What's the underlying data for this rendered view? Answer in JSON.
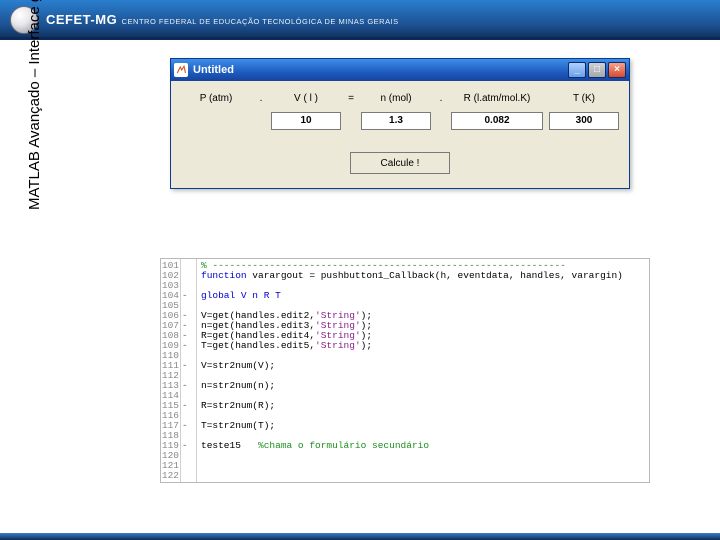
{
  "header": {
    "brand_main": "CEFET",
    "brand_suffix": "-MG",
    "brand_sub": "CENTRO FEDERAL DE EDUCAÇÃO TECNOLÓGICA DE MINAS GERAIS"
  },
  "side_title": "MATLAB  Avançado – Interface gráfica",
  "gui_window": {
    "title": "Untitled",
    "controls": {
      "min": "_",
      "max": "□",
      "close": "×"
    },
    "labels": {
      "P": "P (atm)",
      "V": "V ( l )",
      "eq": "=",
      "dot": ".",
      "n": "n (mol)",
      "R": "R (l.atm/mol.K)",
      "T": "T (K)"
    },
    "values": {
      "V": "10",
      "n": "1.3",
      "R": "0.082",
      "T": "300"
    },
    "button_label": "Calcule !"
  },
  "editor": {
    "lines": [
      {
        "n": "101",
        "b": "",
        "cls": "cmt",
        "t": "% --------------------------------------------------------------"
      },
      {
        "n": "102",
        "b": "",
        "cls": "",
        "t": "function varargout = pushbutton1_Callback(h, eventdata, handles, varargin)"
      },
      {
        "n": "103",
        "b": "",
        "cls": "",
        "t": ""
      },
      {
        "n": "104",
        "b": "-",
        "cls": "kw",
        "t": "global V n R T"
      },
      {
        "n": "105",
        "b": "",
        "cls": "",
        "t": ""
      },
      {
        "n": "106",
        "b": "-",
        "cls": "",
        "t": "V=get(handles.edit2,'String');"
      },
      {
        "n": "107",
        "b": "-",
        "cls": "",
        "t": "n=get(handles.edit3,'String');"
      },
      {
        "n": "108",
        "b": "-",
        "cls": "",
        "t": "R=get(handles.edit4,'String');"
      },
      {
        "n": "109",
        "b": "-",
        "cls": "",
        "t": "T=get(handles.edit5,'String');"
      },
      {
        "n": "110",
        "b": "",
        "cls": "",
        "t": ""
      },
      {
        "n": "111",
        "b": "-",
        "cls": "",
        "t": "V=str2num(V);"
      },
      {
        "n": "112",
        "b": "",
        "cls": "",
        "t": ""
      },
      {
        "n": "113",
        "b": "-",
        "cls": "",
        "t": "n=str2num(n);"
      },
      {
        "n": "114",
        "b": "",
        "cls": "",
        "t": ""
      },
      {
        "n": "115",
        "b": "-",
        "cls": "",
        "t": "R=str2num(R);"
      },
      {
        "n": "116",
        "b": "",
        "cls": "",
        "t": ""
      },
      {
        "n": "117",
        "b": "-",
        "cls": "",
        "t": "T=str2num(T);"
      },
      {
        "n": "118",
        "b": "",
        "cls": "",
        "t": ""
      },
      {
        "n": "119",
        "b": "-",
        "cls": "",
        "t": "teste15   %chama o formulário secundário"
      },
      {
        "n": "120",
        "b": "",
        "cls": "",
        "t": ""
      },
      {
        "n": "121",
        "b": "",
        "cls": "",
        "t": ""
      },
      {
        "n": "122",
        "b": "",
        "cls": "",
        "t": ""
      }
    ]
  }
}
